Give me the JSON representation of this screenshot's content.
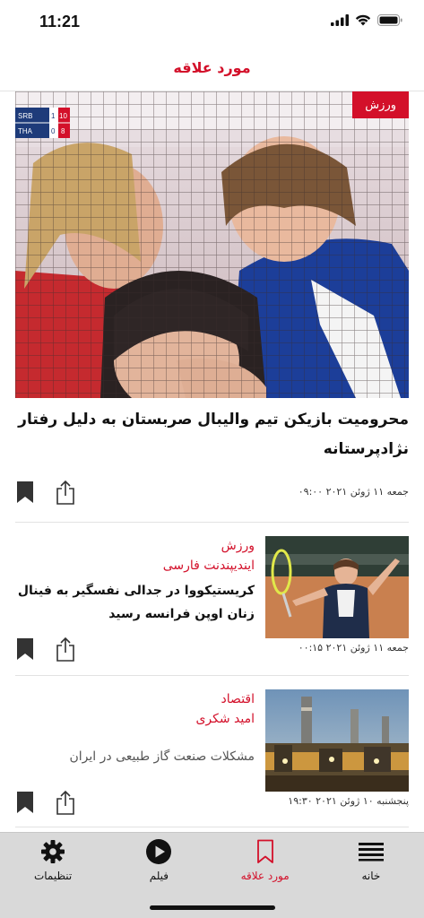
{
  "status_bar": {
    "time": "11:21"
  },
  "header": {
    "title": "مورد علاقه"
  },
  "featured": {
    "category": "ورزش",
    "title": "محرومیت بازیکن تیم والیبال صربستان به دلیل رفتار نژادپرستانه",
    "date": "جمعه ۱۱ ژوئن ۲۰۲۱ ۰۹:۰۰",
    "scoreboard": {
      "team1": "SRB",
      "team1_sets": "1",
      "team1_points": "10",
      "team2": "THA",
      "team2_sets": "0",
      "team2_points": "8"
    }
  },
  "items": [
    {
      "category": "ورزش",
      "author": "ایندیپندنت فارسی",
      "title": "کریستیکووا در جدالی نفسگیر به فینال زنان اوپن فرانسه رسید",
      "date": "جمعه ۱۱ ژوئن ۲۰۲۱ ۰۰:۱۵"
    },
    {
      "category": "اقتصاد",
      "author": "امید شکری",
      "title": "مشکلات صنعت گاز طبیعی در ایران",
      "date": "پنجشنبه ۱۰ ژوئن ۲۰۲۱ ۱۹:۳۰"
    }
  ],
  "tab_bar": {
    "tabs": [
      {
        "label": "تنظیمات",
        "icon": "gear-icon"
      },
      {
        "label": "فیلم",
        "icon": "play-icon"
      },
      {
        "label": "مورد علاقه",
        "icon": "bookmark-icon"
      },
      {
        "label": "خانه",
        "icon": "menu-icon"
      }
    ]
  },
  "colors": {
    "accent": "#d3102a",
    "tab_bar_bg": "#d9d9d9"
  }
}
